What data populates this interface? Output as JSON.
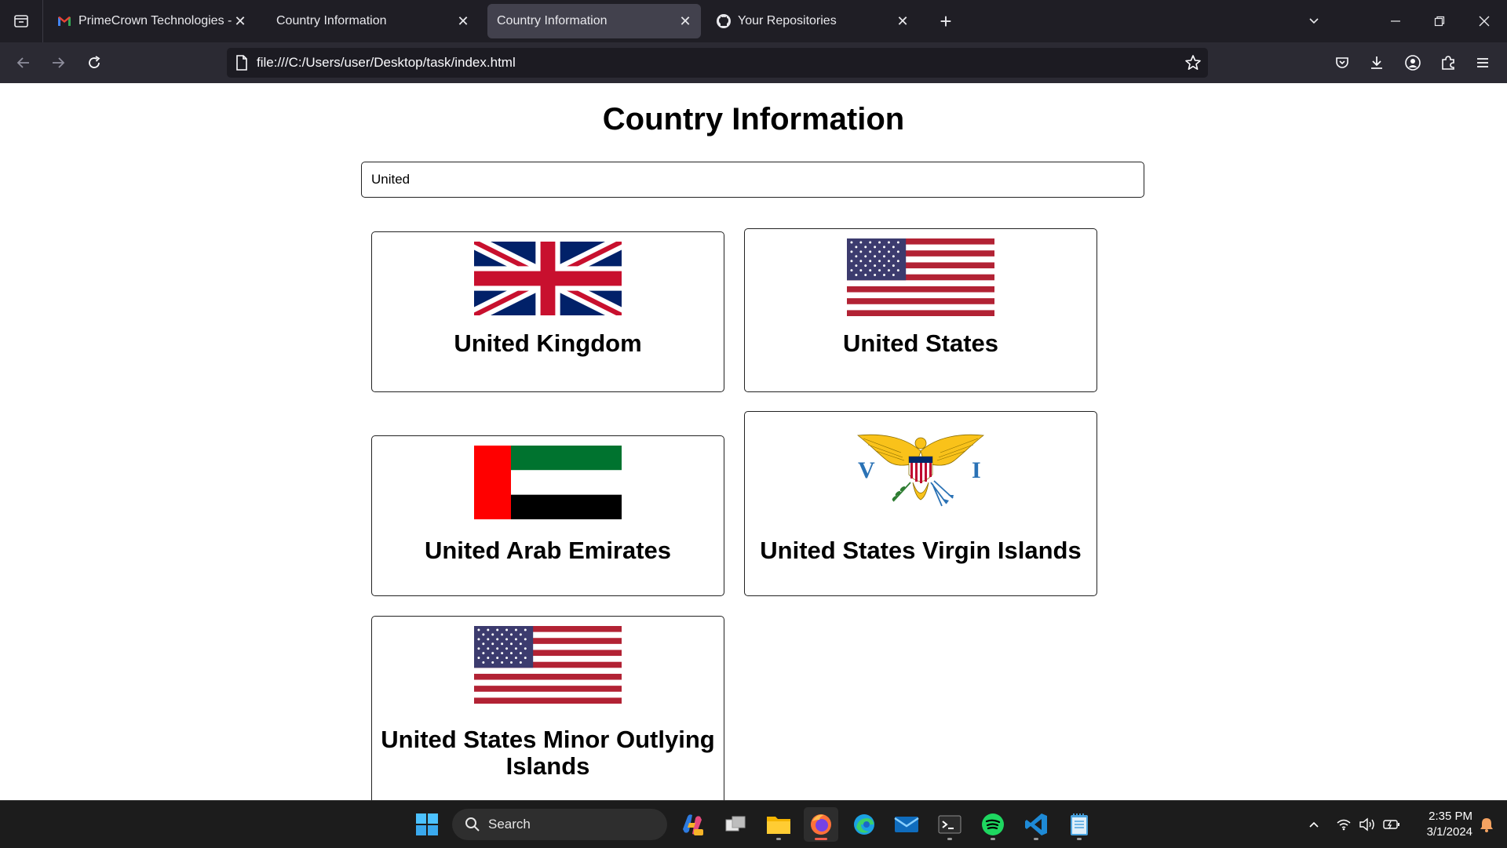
{
  "browser": {
    "tabs": [
      {
        "label": "PrimeCrown Technologies - Full",
        "icon": "gmail-icon",
        "active": false
      },
      {
        "label": "Country Information",
        "icon": "",
        "active": false
      },
      {
        "label": "Country Information",
        "icon": "",
        "active": true
      },
      {
        "label": "Your Repositories",
        "icon": "github-icon",
        "active": false
      }
    ],
    "url": "file:///C:/Users/user/Desktop/task/index.html"
  },
  "page": {
    "title": "Country Information",
    "search_value": "United",
    "cards": [
      {
        "name": "United Kingdom",
        "flag": "uk-flag"
      },
      {
        "name": "United States",
        "flag": "us-flag"
      },
      {
        "name": "United Arab Emirates",
        "flag": "uae-flag"
      },
      {
        "name": "United States Virgin Islands",
        "flag": "usvi-flag"
      },
      {
        "name": "United States Minor Outlying Islands",
        "flag": "us-flag"
      }
    ]
  },
  "taskbar": {
    "search_placeholder": "Search",
    "time": "2:35 PM",
    "date": "3/1/2024"
  },
  "colors": {
    "chrome_dark": "#1f1e25",
    "toolbar": "#2b2a33",
    "firefox_accent": "#f25d4c"
  }
}
